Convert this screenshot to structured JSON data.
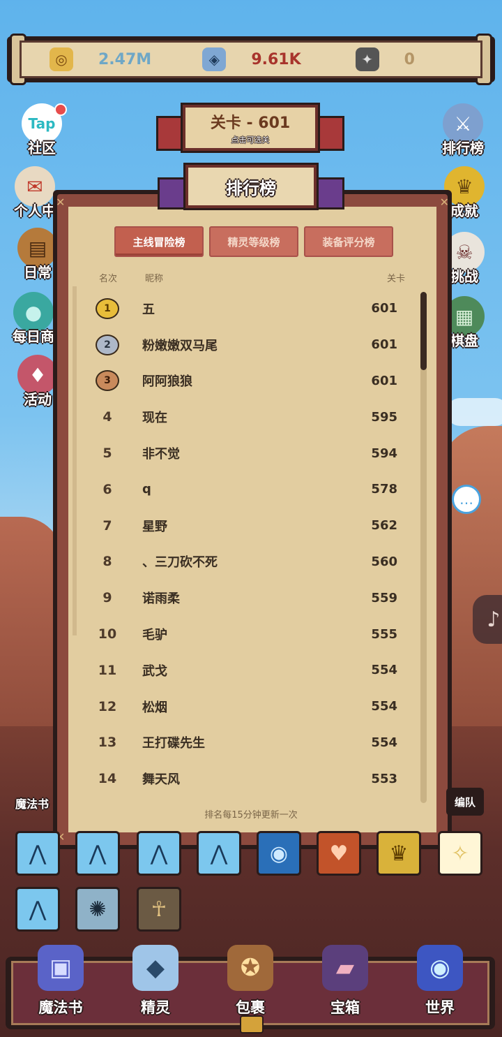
{
  "currencies": [
    {
      "icon": "coin-icon",
      "glyph": "◎",
      "value": "2.47M",
      "color": "#6fa7c6",
      "bg": "#e2b64b"
    },
    {
      "icon": "rune-stone-icon",
      "glyph": "◈",
      "value": "9.61K",
      "color": "#a8342c",
      "bg": "#7fa7d3"
    },
    {
      "icon": "dark-rune-icon",
      "glyph": "✦",
      "value": "0",
      "color": "#b49566",
      "bg": "#555"
    }
  ],
  "side_left": [
    {
      "id": "community",
      "label": "社区",
      "glyph": "Tap",
      "bg": "#ffffff"
    },
    {
      "id": "personal-center",
      "label": "个人中",
      "glyph": "✉",
      "bg": "#e8d9c2"
    },
    {
      "id": "daily",
      "label": "日常",
      "glyph": "▤",
      "bg": "#b57a3b"
    },
    {
      "id": "daily-shop",
      "label": "每日商",
      "glyph": "●",
      "bg": "#3aa8a0"
    },
    {
      "id": "activity",
      "label": "活动",
      "glyph": "♦",
      "bg": "#c4566a"
    }
  ],
  "side_right": [
    {
      "id": "leaderboard",
      "label": "排行榜",
      "glyph": "⚔",
      "bg": "#7ea0cf"
    },
    {
      "id": "achievement",
      "label": "成就",
      "glyph": "♛",
      "bg": "#e0b52f"
    },
    {
      "id": "challenge",
      "label": "挑战",
      "glyph": "☠",
      "bg": "#e9e4dc"
    },
    {
      "id": "chessboard",
      "label": "棋盘",
      "glyph": "▦",
      "bg": "#4e8a5a"
    }
  ],
  "level_banner": {
    "title": "关卡 - 601",
    "subtitle": "点击可选关"
  },
  "panel": {
    "title": "排行榜",
    "tabs": [
      "主线冒险榜",
      "精灵等级榜",
      "装备评分榜"
    ],
    "columns": {
      "rank": "名次",
      "name": "昵称",
      "score": "关卡"
    },
    "rows": [
      {
        "rank": "1",
        "name": "五",
        "score": "601",
        "medal": "gold"
      },
      {
        "rank": "2",
        "name": "粉嫩嫩双马尾",
        "score": "601",
        "medal": "silver"
      },
      {
        "rank": "3",
        "name": "阿阿狼狼",
        "score": "601",
        "medal": "bronze"
      },
      {
        "rank": "4",
        "name": "现在",
        "score": "595"
      },
      {
        "rank": "5",
        "name": "非不觉",
        "score": "594"
      },
      {
        "rank": "6",
        "name": "q",
        "score": "578"
      },
      {
        "rank": "7",
        "name": "星野",
        "score": "562"
      },
      {
        "rank": "8",
        "name": "、三刀砍不死",
        "score": "560"
      },
      {
        "rank": "9",
        "name": "诺雨柔",
        "score": "559"
      },
      {
        "rank": "10",
        "name": "毛驴",
        "score": "555"
      },
      {
        "rank": "11",
        "name": "武戈",
        "score": "554"
      },
      {
        "rank": "12",
        "name": "松烟",
        "score": "554"
      },
      {
        "rank": "13",
        "name": "王打碟先生",
        "score": "554"
      },
      {
        "rank": "14",
        "name": "舞天风",
        "score": "553"
      }
    ],
    "footer": "排名每15分钟更新一次"
  },
  "magic_book_label": "魔法书",
  "team_label": "编队",
  "skill_slots": [
    {
      "icon": "claw-slash-icon",
      "bg": "#7cc7ee",
      "glyph": "⋀"
    },
    {
      "icon": "claw-slash-icon",
      "bg": "#7cc7ee",
      "glyph": "⋀"
    },
    {
      "icon": "claw-slash-icon",
      "bg": "#7cc7ee",
      "glyph": "⋀"
    },
    {
      "icon": "claw-slash-icon",
      "bg": "#7cc7ee",
      "glyph": "⋀"
    },
    {
      "icon": "water-swirl-icon",
      "bg": "#2a6fb8",
      "glyph": "◉"
    },
    {
      "icon": "fire-heart-icon",
      "bg": "#c2532a",
      "glyph": "♥"
    },
    {
      "icon": "golden-crown-icon",
      "bg": "#d9b23a",
      "glyph": "♛"
    },
    {
      "icon": "light-burst-icon",
      "bg": "#fff6d6",
      "glyph": "✧"
    },
    {
      "icon": "claw-slash-icon",
      "bg": "#7cc7ee",
      "glyph": "⋀"
    },
    {
      "icon": "ghost-sawblade-icon",
      "bg": "#8fb2c8",
      "glyph": "✺"
    },
    {
      "icon": "scarecrow-icon",
      "bg": "#6b5a44",
      "glyph": "☥"
    }
  ],
  "bottom_nav": [
    {
      "id": "magic-book",
      "label": "魔法书",
      "glyph": "▣",
      "bg": "#5a63c8"
    },
    {
      "id": "spirit",
      "label": "精灵",
      "glyph": "◆",
      "bg": "#9fc5e8"
    },
    {
      "id": "bag",
      "label": "包裹",
      "glyph": "✪",
      "bg": "#a0693a"
    },
    {
      "id": "chest",
      "label": "宝箱",
      "glyph": "▰",
      "bg": "#5b3f7c"
    },
    {
      "id": "world",
      "label": "世界",
      "glyph": "◉",
      "bg": "#3d56c2"
    }
  ]
}
